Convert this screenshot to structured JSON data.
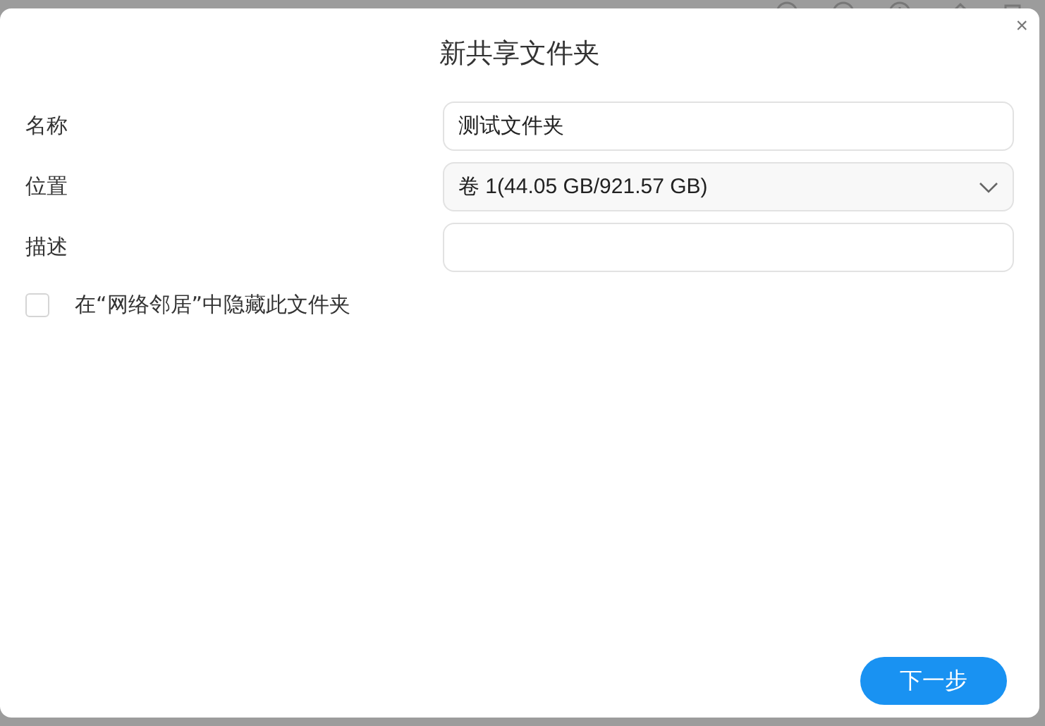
{
  "dialog": {
    "title": "新共享文件夹",
    "close": "×"
  },
  "fields": [
    {
      "kind": "text",
      "label": "名称",
      "value": "测试文件夹"
    },
    {
      "kind": "select",
      "label": "位置",
      "value": "卷 1(44.05 GB/921.57 GB)"
    },
    {
      "kind": "text",
      "label": "描述"
    }
  ],
  "hide_option": {
    "label": "在“网络邻居”中隐藏此文件夹",
    "checked": false
  },
  "next_button": "下一步"
}
